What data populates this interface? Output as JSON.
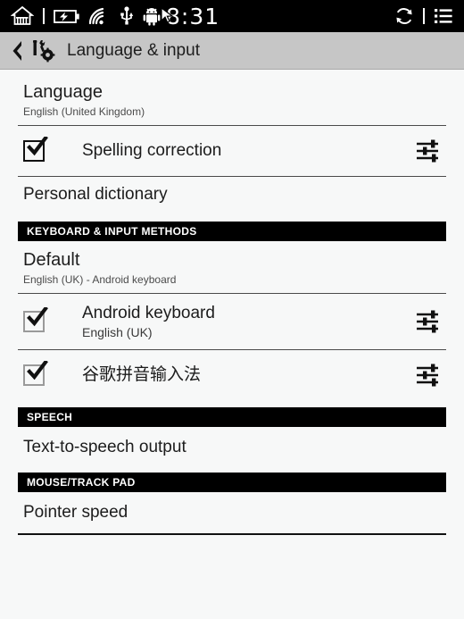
{
  "statusbar": {
    "left_icons": [
      "home-icon",
      "separator",
      "battery-charging-icon",
      "wifi-icon",
      "usb-icon",
      "android-robot-icon"
    ],
    "clock": "8:31",
    "right_icons": [
      "rotate-icon",
      "separator",
      "list-menu-icon"
    ]
  },
  "titlebar": {
    "back_icon": "back-chevron-icon",
    "app_icon": "settings-tools-icon",
    "title": "Language & input"
  },
  "settings": {
    "language": {
      "title": "Language",
      "subtitle": "English (United Kingdom)"
    },
    "spelling_correction": {
      "label": "Spelling correction",
      "checked": true,
      "gear_icon": "sliders-settings-icon"
    },
    "personal_dictionary": {
      "label": "Personal dictionary"
    },
    "keyboard_section": {
      "header": "KEYBOARD & INPUT METHODS"
    },
    "default_keyboard": {
      "title": "Default",
      "subtitle": "English (UK) - Android keyboard"
    },
    "android_keyboard": {
      "label": "Android keyboard",
      "sublabel": "English (UK)",
      "checked": true,
      "gear_icon": "sliders-settings-icon"
    },
    "google_pinyin": {
      "label": "谷歌拼音输入法",
      "checked": true,
      "gear_icon": "sliders-settings-icon"
    },
    "speech_section": {
      "header": "SPEECH"
    },
    "text_to_speech": {
      "label": "Text-to-speech output"
    },
    "mouse_section": {
      "header": "MOUSE/TRACK PAD"
    },
    "pointer_speed": {
      "label": "Pointer speed"
    }
  },
  "colors": {
    "statusbar_bg": "#000000",
    "titlebar_bg": "#c6c6c6",
    "content_bg": "#f7f8f8",
    "section_header_bg": "#000000",
    "text_primary": "#1c1c1c",
    "text_secondary": "#4b4b4b"
  }
}
